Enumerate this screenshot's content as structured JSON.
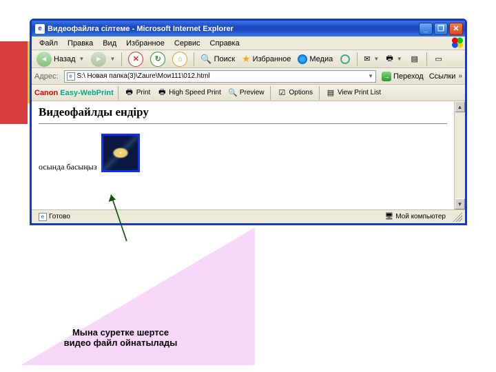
{
  "decor": {
    "annot_line1": "Мына суретке шертсе",
    "annot_line2": "видео файл ойнатылады"
  },
  "window": {
    "title": "Видеофайлға сілтеме - Microsoft Internet Explorer",
    "buttons": {
      "min": "_",
      "max": "❐",
      "close": "✕"
    }
  },
  "menu": {
    "file": "Файл",
    "edit": "Правка",
    "view": "Вид",
    "fav": "Избранное",
    "tools": "Сервис",
    "help": "Справка"
  },
  "tb": {
    "back": "Назад",
    "search": "Поиск",
    "fav": "Избранное",
    "media": "Медиа"
  },
  "addr": {
    "label": "Адрес:",
    "value": "S:\\ Новая папка(3)\\Zaure\\Мои111\\012.html",
    "go": "Переход",
    "links": "Ссылки"
  },
  "canon": {
    "brand_c": "Canon",
    "brand_e": "Easy-WebPrint",
    "print": "Print",
    "hsp": "High Speed Print",
    "preview": "Preview",
    "options": "Options",
    "viewlist": "View Print List"
  },
  "page": {
    "heading": "Видеофайлды ендіру",
    "caption": "осында басыңыз"
  },
  "status": {
    "ready": "Готово",
    "zone": "Мой компьютер"
  }
}
